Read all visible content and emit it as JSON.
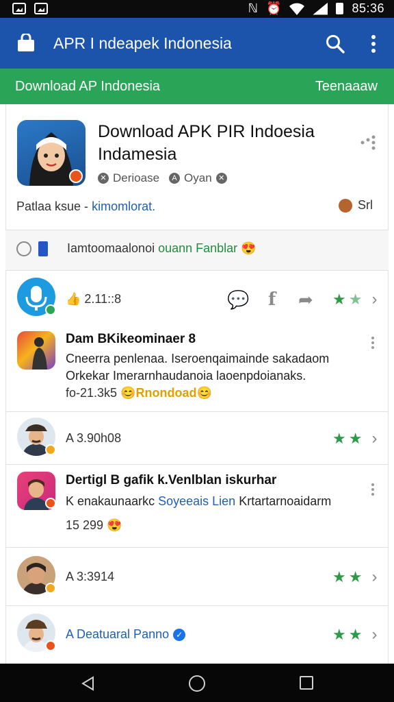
{
  "status_bar": {
    "time": "85:36"
  },
  "app_bar": {
    "title": "APR I ndeapek Indonesia"
  },
  "tab_bar": {
    "left_label": "Download AP Indonesia",
    "right_label": "Teenaaaw"
  },
  "header_card": {
    "title": "Download APK PIR Indoesia Indamesia",
    "meta": [
      "Derioase",
      "Oyan"
    ],
    "publisher_prefix": "Patlaa ksue -",
    "publisher_link": "kimomlorat.",
    "seller": "Srl"
  },
  "promo": {
    "text": "Iamtoomaalonoi",
    "highlight": "ouann Fanblar"
  },
  "items": [
    {
      "type": "app",
      "meta": "2.11::8",
      "stars": 2
    },
    {
      "type": "post",
      "title": "Dam BKikeominaer 8",
      "body": "Cneerra penlenaa. Iseroenqaimainde sakadaom Orkekar Imerarnhaudanoia laoenpdoianaks.",
      "meta": "fo-21.3k5",
      "meta_gold": "Rnondoad"
    },
    {
      "type": "app",
      "meta": "A 3.90h08",
      "stars": 2
    },
    {
      "type": "post",
      "title": "Dertigl B gafik k.Venlblan iskurhar",
      "body_prefix": "K enakaunaarkc",
      "body_link": "Soyeeais Lien",
      "body_suffix": "Krtartarnoaidarm",
      "meta": "15 299"
    },
    {
      "type": "app",
      "meta": "A 3:3914",
      "stars": 2
    },
    {
      "type": "app",
      "name": "A Deatuaral Panno",
      "stars": 2
    }
  ],
  "colors": {
    "app_bar": "#1c53ab",
    "tab_bar": "#2aa457",
    "star": "#2e9a49",
    "link": "#1f5fb3"
  }
}
